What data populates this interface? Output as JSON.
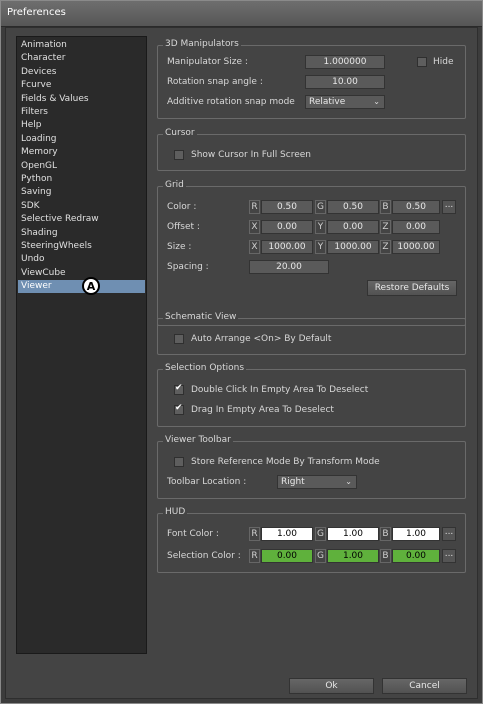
{
  "window": {
    "title": "Preferences"
  },
  "sidebar": {
    "items": [
      {
        "label": "Animation"
      },
      {
        "label": "Character"
      },
      {
        "label": "Devices"
      },
      {
        "label": "Fcurve"
      },
      {
        "label": "Fields & Values"
      },
      {
        "label": "Filters"
      },
      {
        "label": "Help"
      },
      {
        "label": "Loading"
      },
      {
        "label": "Memory"
      },
      {
        "label": "OpenGL"
      },
      {
        "label": "Python"
      },
      {
        "label": "Saving"
      },
      {
        "label": "SDK"
      },
      {
        "label": "Selective Redraw"
      },
      {
        "label": "Shading"
      },
      {
        "label": "SteeringWheels"
      },
      {
        "label": "Undo"
      },
      {
        "label": "ViewCube"
      },
      {
        "label": "Viewer"
      }
    ],
    "selected": "Viewer",
    "marker": "A"
  },
  "manipulators": {
    "title": "3D Manipulators",
    "size_label": "Manipulator Size :",
    "size_value": "1.000000",
    "hide_label": "Hide",
    "snap_label": "Rotation snap angle :",
    "snap_value": "10.00",
    "mode_label": "Additive rotation snap mode",
    "mode_value": "Relative"
  },
  "cursor": {
    "title": "Cursor",
    "show_label": "Show Cursor In Full Screen"
  },
  "grid": {
    "title": "Grid",
    "color_label": "Color :",
    "color": {
      "r": "0.50",
      "g": "0.50",
      "b": "0.50"
    },
    "offset_label": "Offset :",
    "offset": {
      "x": "0.00",
      "y": "0.00",
      "z": "0.00"
    },
    "size_label": "Size :",
    "size": {
      "x": "1000.00",
      "y": "1000.00",
      "z": "1000.00"
    },
    "spacing_label": "Spacing :",
    "spacing_value": "20.00",
    "restore_label": "Restore Defaults",
    "tags": {
      "r": "R",
      "g": "G",
      "b": "B",
      "x": "X",
      "y": "Y",
      "z": "Z"
    },
    "dots": "..."
  },
  "schematic": {
    "title": "Schematic View",
    "auto_label": "Auto Arrange <On> By Default"
  },
  "selection": {
    "title": "Selection Options",
    "double_click_label": "Double Click In Empty Area To Deselect",
    "drag_label": "Drag In Empty Area To Deselect"
  },
  "viewer_toolbar": {
    "title": "Viewer Toolbar",
    "store_label": "Store Reference Mode By Transform Mode",
    "location_label": "Toolbar Location :",
    "location_value": "Right"
  },
  "hud": {
    "title": "HUD",
    "font_color_label": "Font Color :",
    "font_color": {
      "r": "1.00",
      "g": "1.00",
      "b": "1.00"
    },
    "selection_color_label": "Selection Color :",
    "selection_color": {
      "r": "0.00",
      "g": "1.00",
      "b": "0.00"
    }
  },
  "footer": {
    "ok_label": "Ok",
    "cancel_label": "Cancel"
  }
}
